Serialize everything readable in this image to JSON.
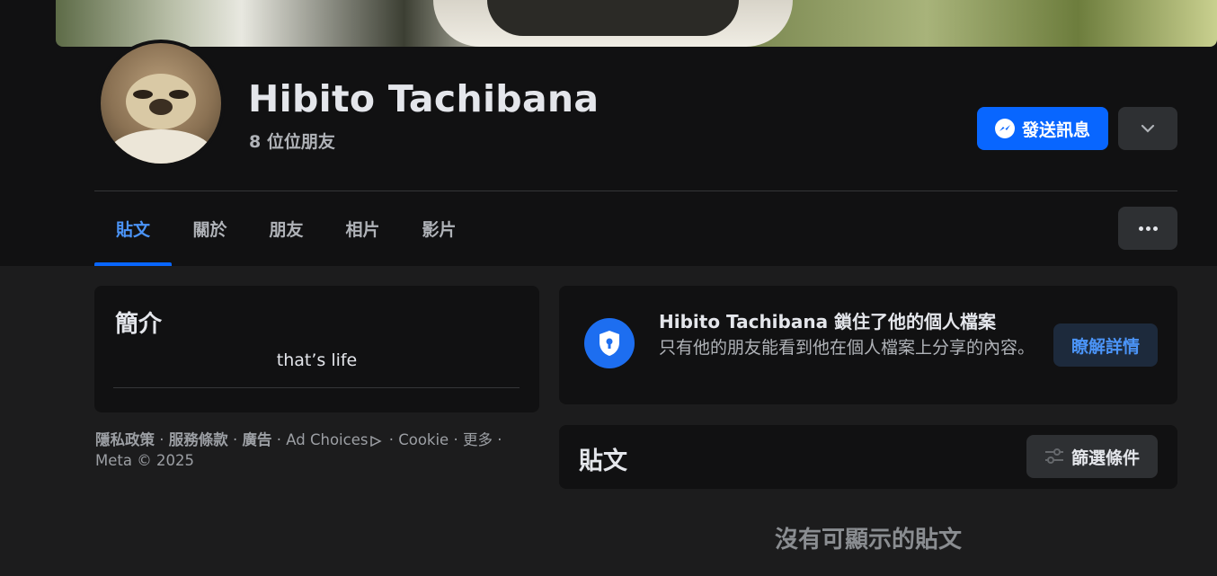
{
  "profile": {
    "name": "Hibito Tachibana",
    "friends_count": "8 位位朋友",
    "message_button": "發送訊息"
  },
  "tabs": [
    {
      "label": "貼文",
      "active": true
    },
    {
      "label": "關於",
      "active": false
    },
    {
      "label": "朋友",
      "active": false
    },
    {
      "label": "相片",
      "active": false
    },
    {
      "label": "影片",
      "active": false
    }
  ],
  "intro": {
    "title": "簡介",
    "bio": "that’s life"
  },
  "footer": {
    "privacy": "隱私政策",
    "terms": "服務條款",
    "ads": "廣告",
    "ad_choices": "Ad Choices",
    "cookie": "Cookie",
    "more": "更多",
    "copyright": "Meta © 2025"
  },
  "locked": {
    "title": "Hibito Tachibana 鎖住了他的個人檔案",
    "description": "只有他的朋友能看到他在個人檔案上分享的內容。",
    "learn_more": "瞭解詳情"
  },
  "posts": {
    "title": "貼文",
    "filter_button": "篩選條件",
    "empty": "沒有可顯示的貼文"
  },
  "colors": {
    "accent": "#0866ff",
    "active_tab": "#4b94f7",
    "card": "#111112",
    "background": "#1c1c1d"
  },
  "icons": [
    "messenger-icon",
    "chevron-down-icon",
    "more-dots-icon",
    "shield-lock-icon",
    "filter-sliders-icon",
    "ad-choices-icon"
  ]
}
